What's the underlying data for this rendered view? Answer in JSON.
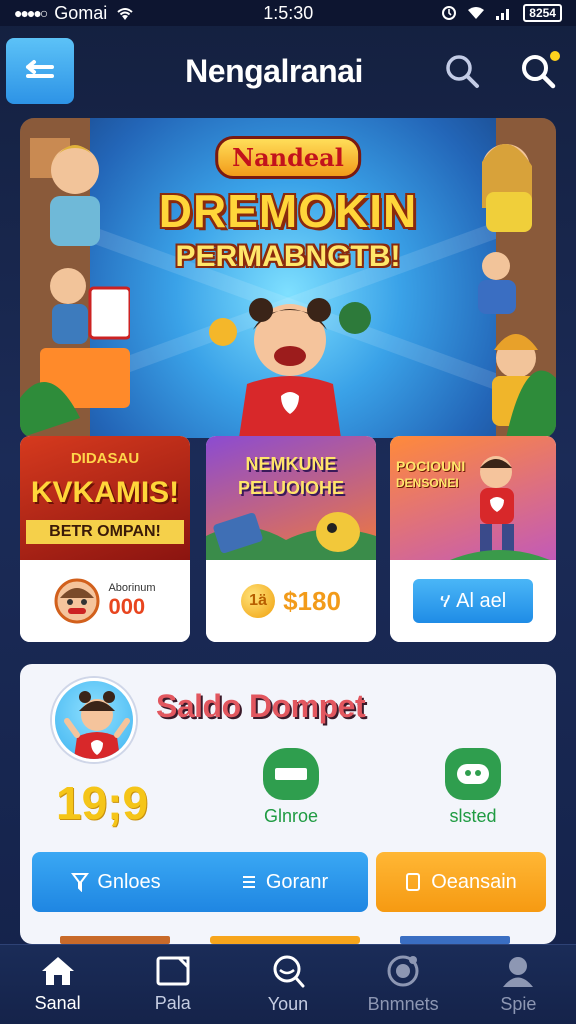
{
  "status_bar": {
    "carrier": "Gomai",
    "time": "1:5:30",
    "battery": "8254"
  },
  "header": {
    "title": "Nengalranai"
  },
  "hero": {
    "brand": "Nandeal",
    "title_line1": "DREMOKIN",
    "title_line2": "PERMABNGTB!"
  },
  "promos": [
    {
      "line1": "DIDASAU",
      "line2": "KVKAMIS!",
      "line3": "BETR OMPAN!",
      "badge_label": "Aborinum",
      "value": "000"
    },
    {
      "line1": "NEMKUNE",
      "line2": "PELUOIOHE",
      "coin_symbol": "1ä",
      "value": "$180"
    },
    {
      "line1": "POCIOUNI",
      "line2": "DENSONEI",
      "button_label": "ሃ Al ael"
    }
  ],
  "wallet": {
    "title": "Saldo Dompet",
    "balance": "19;9",
    "stats": [
      {
        "label": "Glnroe"
      },
      {
        "label": "slsted"
      }
    ],
    "buttons": {
      "left_a": "Gnloes",
      "left_b": "Goranr",
      "right": "Oeansain"
    }
  },
  "nav": [
    {
      "label": "Sanal",
      "icon": "home-icon"
    },
    {
      "label": "Pala",
      "icon": "card-icon"
    },
    {
      "label": "Youn",
      "icon": "search-icon"
    },
    {
      "label": "Bnmnets",
      "icon": "badge-icon"
    },
    {
      "label": "Spie",
      "icon": "profile-icon"
    }
  ],
  "colors": {
    "accent_blue": "#2d93e6",
    "accent_orange": "#f7a51c",
    "wallet_title": "#e2575f",
    "balance_gold": "#f5c518"
  }
}
